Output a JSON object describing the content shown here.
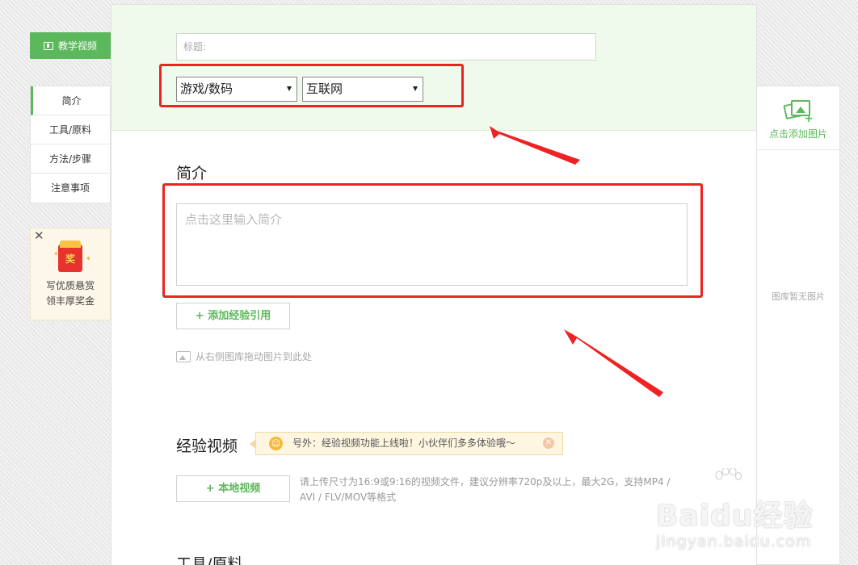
{
  "left": {
    "video_button": "教学视频",
    "nav": [
      "简介",
      "工具/原料",
      "方法/步骤",
      "注意事项"
    ],
    "reward": {
      "close": "✕",
      "badge": "奖",
      "line1": "写优质悬赏",
      "line2": "领丰厚奖金"
    }
  },
  "main": {
    "title_placeholder": "标题:",
    "category_primary": "游戏/数码",
    "category_secondary": "互联网",
    "intro_heading": "简介",
    "intro_placeholder": "点击这里输入简介",
    "add_reference_button": "+ 添加经验引用",
    "drag_hint": "从右侧图库拖动图片到此处",
    "video_heading": "经验视频",
    "notice_text": "号外：经验视频功能上线啦！小伙伴们多多体验哦～",
    "local_video_button": "+ 本地视频",
    "video_hint": "请上传尺寸为16:9或9:16的视频文件，建议分辨率720p及以上，最大2G，支持MP4 / AVI / FLV/MOV等格式",
    "tools_heading": "工具/原料"
  },
  "right": {
    "add_image": "点击添加图片",
    "empty_gallery": "图库暂无图片"
  },
  "watermark": {
    "brand": "Baidu经验",
    "url": "jingyan.baidu.com"
  },
  "colors": {
    "accent_green": "#5cb85c",
    "annotation_red": "#ee2222",
    "top_panel_bg": "#effaec"
  },
  "icons": [
    "film-icon",
    "red-envelope-icon",
    "image-add-icon",
    "image-icon",
    "smile-icon",
    "close-icon",
    "arrow-down-icon"
  ]
}
